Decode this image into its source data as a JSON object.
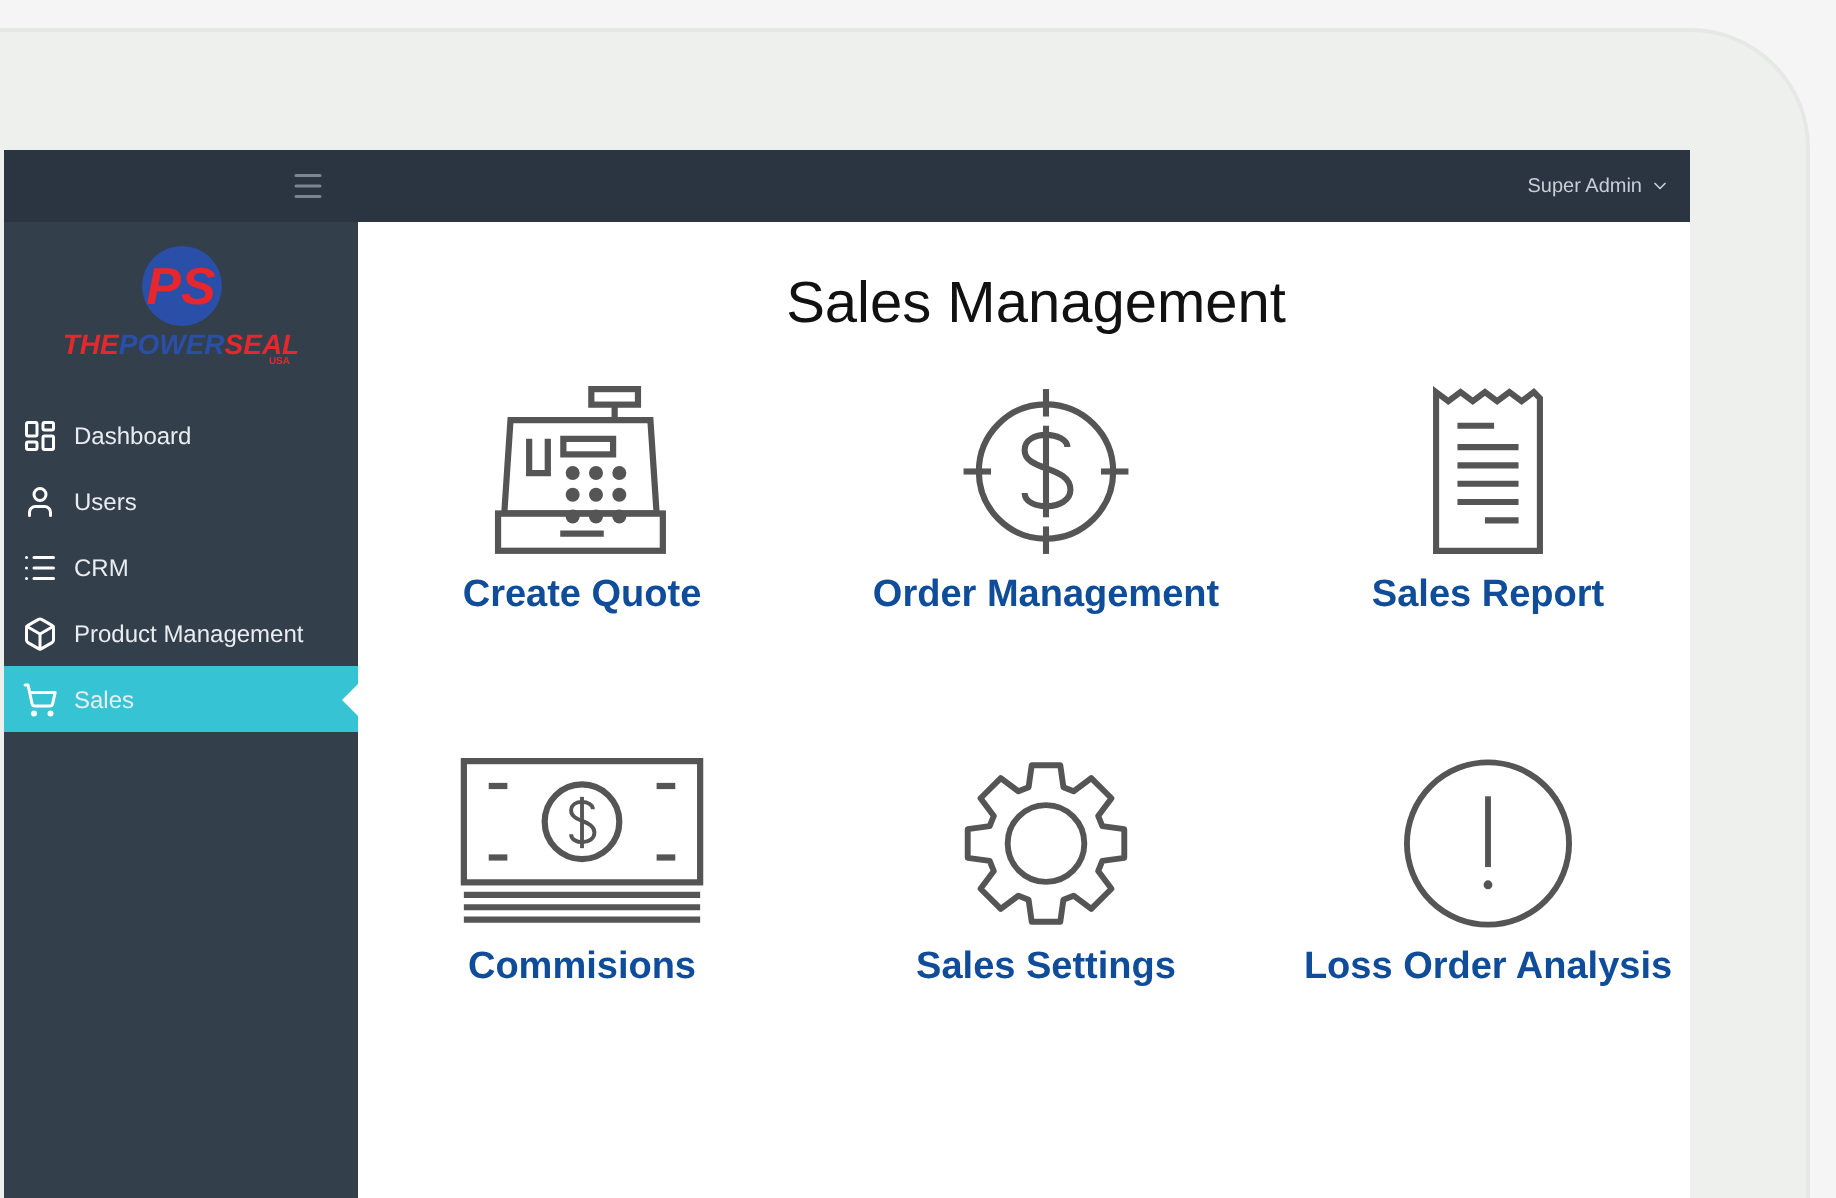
{
  "logo": {
    "monogram": "PS",
    "wordmark": [
      "THE",
      "POWER",
      "SEAL"
    ],
    "tag": "USA"
  },
  "topbar": {
    "user": "Super Admin"
  },
  "sidebar": {
    "items": [
      {
        "label": "Dashboard",
        "selected": false
      },
      {
        "label": "Users",
        "selected": false
      },
      {
        "label": "CRM",
        "selected": false
      },
      {
        "label": "Product Management",
        "selected": false
      },
      {
        "label": "Sales",
        "selected": true
      }
    ]
  },
  "title": "Sales Management",
  "tiles": [
    {
      "label": "Create Quote"
    },
    {
      "label": "Order Management"
    },
    {
      "label": "Sales Report"
    },
    {
      "label": "Commisions"
    },
    {
      "label": "Sales Settings"
    },
    {
      "label": "Loss Order Analysis"
    }
  ]
}
